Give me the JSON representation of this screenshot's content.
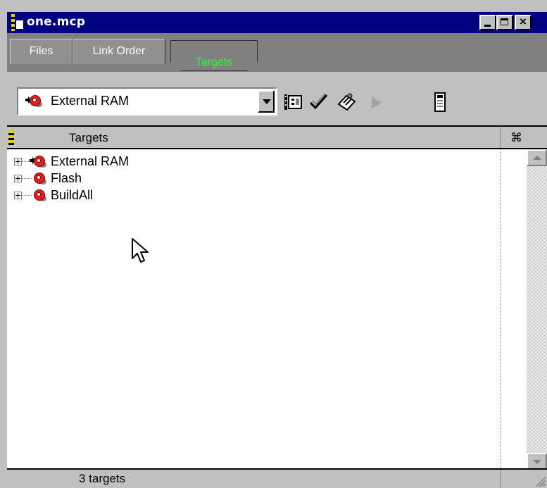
{
  "window": {
    "title": "one.mcp"
  },
  "tabs": [
    {
      "label": "Files",
      "active": false
    },
    {
      "label": "Link Order",
      "active": false
    },
    {
      "label": "Targets",
      "active": true
    }
  ],
  "toolbar": {
    "selected_target": "External RAM",
    "buttons": [
      "target-settings-icon",
      "check-syntax-icon",
      "compile-icon",
      "run-icon",
      "debug-icon"
    ]
  },
  "list": {
    "column_header": "Targets",
    "link_column_icon": "link-icon",
    "items": [
      {
        "name": "External RAM",
        "current": true
      },
      {
        "name": "Flash",
        "current": false
      },
      {
        "name": "BuildAll",
        "current": false
      }
    ]
  },
  "status": {
    "text": "3 targets"
  },
  "colors": {
    "titlebar": "#000080",
    "active_tab_text": "#39f046",
    "target_icon": "#e02020"
  }
}
